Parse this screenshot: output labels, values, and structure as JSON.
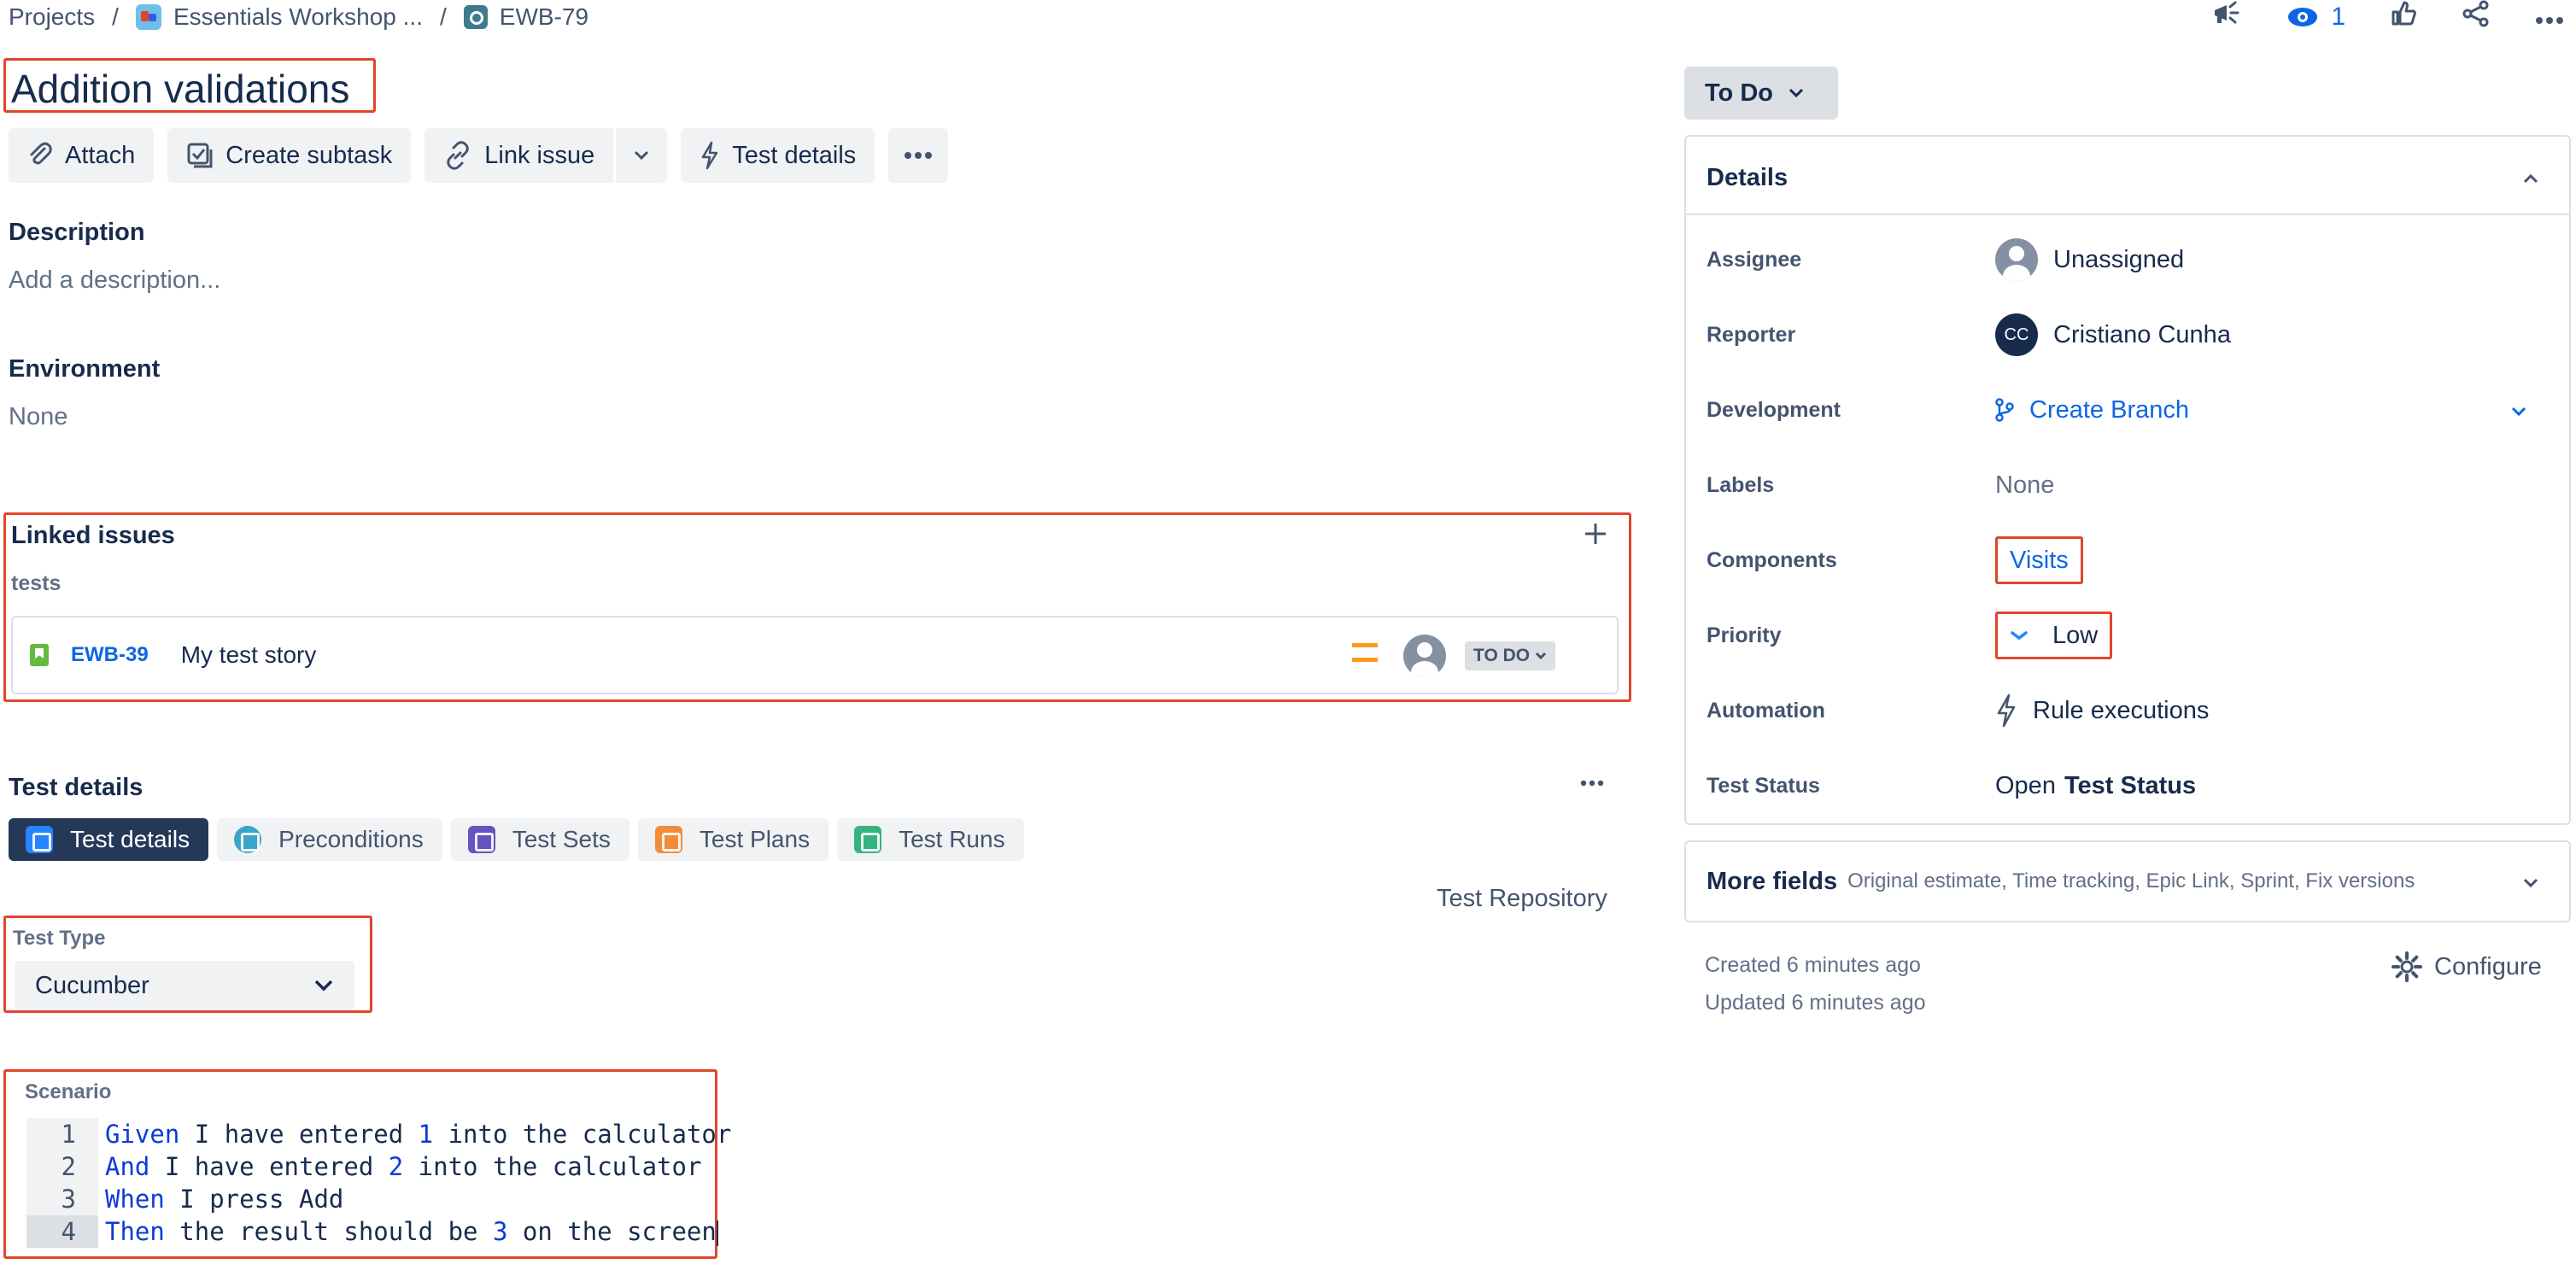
{
  "breadcrumb": {
    "projects": "Projects",
    "project": "Essentials Workshop ...",
    "issue_key": "EWB-79",
    "sep": "/"
  },
  "top": {
    "watch_count": "1"
  },
  "issue": {
    "title": "Addition validations"
  },
  "toolbar": {
    "attach": "Attach",
    "create_subtask": "Create subtask",
    "link_issue": "Link issue",
    "test_details": "Test details"
  },
  "description": {
    "heading": "Description",
    "placeholder": "Add a description..."
  },
  "environment": {
    "heading": "Environment",
    "value": "None"
  },
  "linked_issues": {
    "heading": "Linked issues",
    "relation": "tests",
    "items": [
      {
        "key": "EWB-39",
        "summary": "My test story",
        "status": "TO DO"
      }
    ]
  },
  "test_details": {
    "heading": "Test details",
    "tabs": [
      "Test details",
      "Preconditions",
      "Test Sets",
      "Test Plans",
      "Test Runs"
    ],
    "repository": "Test Repository",
    "test_type_label": "Test Type",
    "test_type_value": "Cucumber",
    "scenario_label": "Scenario",
    "scenario_lines": [
      {
        "n": "1",
        "kw": "Given",
        "a": " I have entered ",
        "num": "1",
        "b": " into the calculator"
      },
      {
        "n": "2",
        "kw": "And",
        "a": " I have entered ",
        "num": "2",
        "b": " into the calculator"
      },
      {
        "n": "3",
        "kw": "When",
        "a": " I press Add",
        "num": "",
        "b": ""
      },
      {
        "n": "4",
        "kw": "Then",
        "a": " the result should be ",
        "num": "3",
        "b": " on the screen"
      }
    ]
  },
  "status": {
    "label": "To Do"
  },
  "details": {
    "heading": "Details",
    "fields": {
      "assignee": {
        "label": "Assignee",
        "value": "Unassigned"
      },
      "reporter": {
        "label": "Reporter",
        "value": "Cristiano Cunha",
        "initials": "CC"
      },
      "development": {
        "label": "Development",
        "value": "Create Branch"
      },
      "labels": {
        "label": "Labels",
        "value": "None"
      },
      "components": {
        "label": "Components",
        "value": "Visits"
      },
      "priority": {
        "label": "Priority",
        "value": "Low"
      },
      "automation": {
        "label": "Automation",
        "value": "Rule executions"
      },
      "test_status": {
        "label": "Test Status",
        "value_prefix": "Open",
        "value_strong": "Test Status"
      }
    }
  },
  "more_fields": {
    "heading": "More fields",
    "list": "Original estimate, Time tracking, Epic Link, Sprint, Fix versions"
  },
  "meta": {
    "created": "Created 6 minutes ago",
    "updated": "Updated 6 minutes ago",
    "configure": "Configure"
  },
  "colors": {
    "highlight": "#e2452b",
    "link": "#0c66e4",
    "active_tab": "#253858",
    "priority_low": "#2684ff",
    "priority_medium": "#ff991f"
  },
  "icons": {
    "top": [
      "megaphone-icon",
      "eye-icon",
      "thumbs-up-icon",
      "share-icon",
      "more-icon"
    ],
    "toolbar": [
      "paperclip-icon",
      "subtask-icon",
      "link-icon",
      "chevron-down-icon",
      "bolt-icon",
      "more-icon"
    ]
  }
}
